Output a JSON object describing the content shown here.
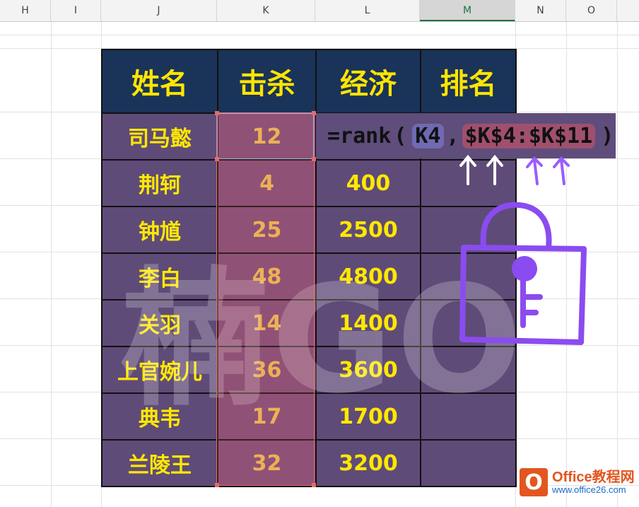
{
  "columns": [
    "H",
    "I",
    "J",
    "K",
    "L",
    "M",
    "N",
    "O"
  ],
  "active_column": "M",
  "table": {
    "headers": [
      "姓名",
      "击杀",
      "经济",
      "排名"
    ],
    "rows": [
      [
        "司马懿",
        "12",
        "",
        ""
      ],
      [
        "荆轲",
        "4",
        "400",
        ""
      ],
      [
        "钟馗",
        "25",
        "2500",
        ""
      ],
      [
        "李白",
        "48",
        "4800",
        ""
      ],
      [
        "关羽",
        "14",
        "1400",
        ""
      ],
      [
        "上官婉儿",
        "36",
        "3600",
        ""
      ],
      [
        "典韦",
        "17",
        "1700",
        ""
      ],
      [
        "兰陵王",
        "32",
        "3200",
        ""
      ]
    ]
  },
  "formula": {
    "prefix": "=rank",
    "open": "(",
    "ref1": "K4",
    "comma": ",",
    "ref2": "$K$4:$K$11",
    "close": ")"
  },
  "watermark": "楠GO",
  "logo": {
    "mark": "O",
    "title": "Office教程网",
    "url": "www.office26.com"
  },
  "colors": {
    "header_bg": "#1a3358",
    "cell_bg": "#5f4b78",
    "text_yellow": "#ffe800",
    "lock_purple": "#8a4cf0",
    "logo_orange": "#e3561f"
  }
}
